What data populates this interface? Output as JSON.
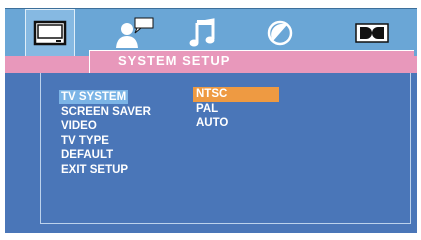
{
  "header": {
    "title": "SYSTEM SETUP"
  },
  "toolbar": {
    "icons": [
      {
        "name": "tv-monitor-icon",
        "active": true
      },
      {
        "name": "person-speech-icon",
        "active": false
      },
      {
        "name": "music-note-icon",
        "active": false
      },
      {
        "name": "circle-slash-icon",
        "active": false
      },
      {
        "name": "dolby-icon",
        "active": false
      }
    ]
  },
  "menu": {
    "items": [
      {
        "label": "TV SYSTEM",
        "selected": true
      },
      {
        "label": "SCREEN SAVER",
        "selected": false
      },
      {
        "label": "VIDEO",
        "selected": false
      },
      {
        "label": "TV TYPE",
        "selected": false
      },
      {
        "label": "DEFAULT",
        "selected": false
      },
      {
        "label": "EXIT SETUP",
        "selected": false
      }
    ]
  },
  "options": {
    "items": [
      {
        "label": "NTSC",
        "highlighted": true
      },
      {
        "label": "PAL",
        "highlighted": false
      },
      {
        "label": "AUTO",
        "highlighted": false
      }
    ]
  },
  "colors": {
    "topbar": "#6aa6d6",
    "title_band": "#e898bb",
    "panel": "#4a76b8",
    "selection": "#7bb4e6",
    "option_highlight": "#ee9a42"
  }
}
